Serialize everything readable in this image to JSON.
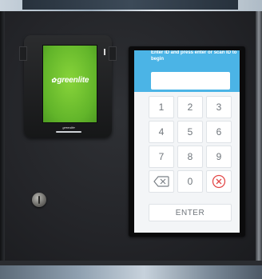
{
  "reader": {
    "brand": "greenlite",
    "footer_brand": "greenlite"
  },
  "kiosk": {
    "instruction": "Enter ID and press enter or scan ID to begin",
    "id_input": {
      "value": "",
      "placeholder": ""
    },
    "keys": [
      "1",
      "2",
      "3",
      "4",
      "5",
      "6",
      "7",
      "8",
      "9"
    ],
    "key_0": "0",
    "backspace_icon": "backspace-icon",
    "clear_icon": "clear-x-circle-icon",
    "enter_label": "ENTER"
  },
  "colors": {
    "header_blue": "#4bb4e6",
    "reader_green": "#6cc02f",
    "clear_red": "#e34848"
  }
}
